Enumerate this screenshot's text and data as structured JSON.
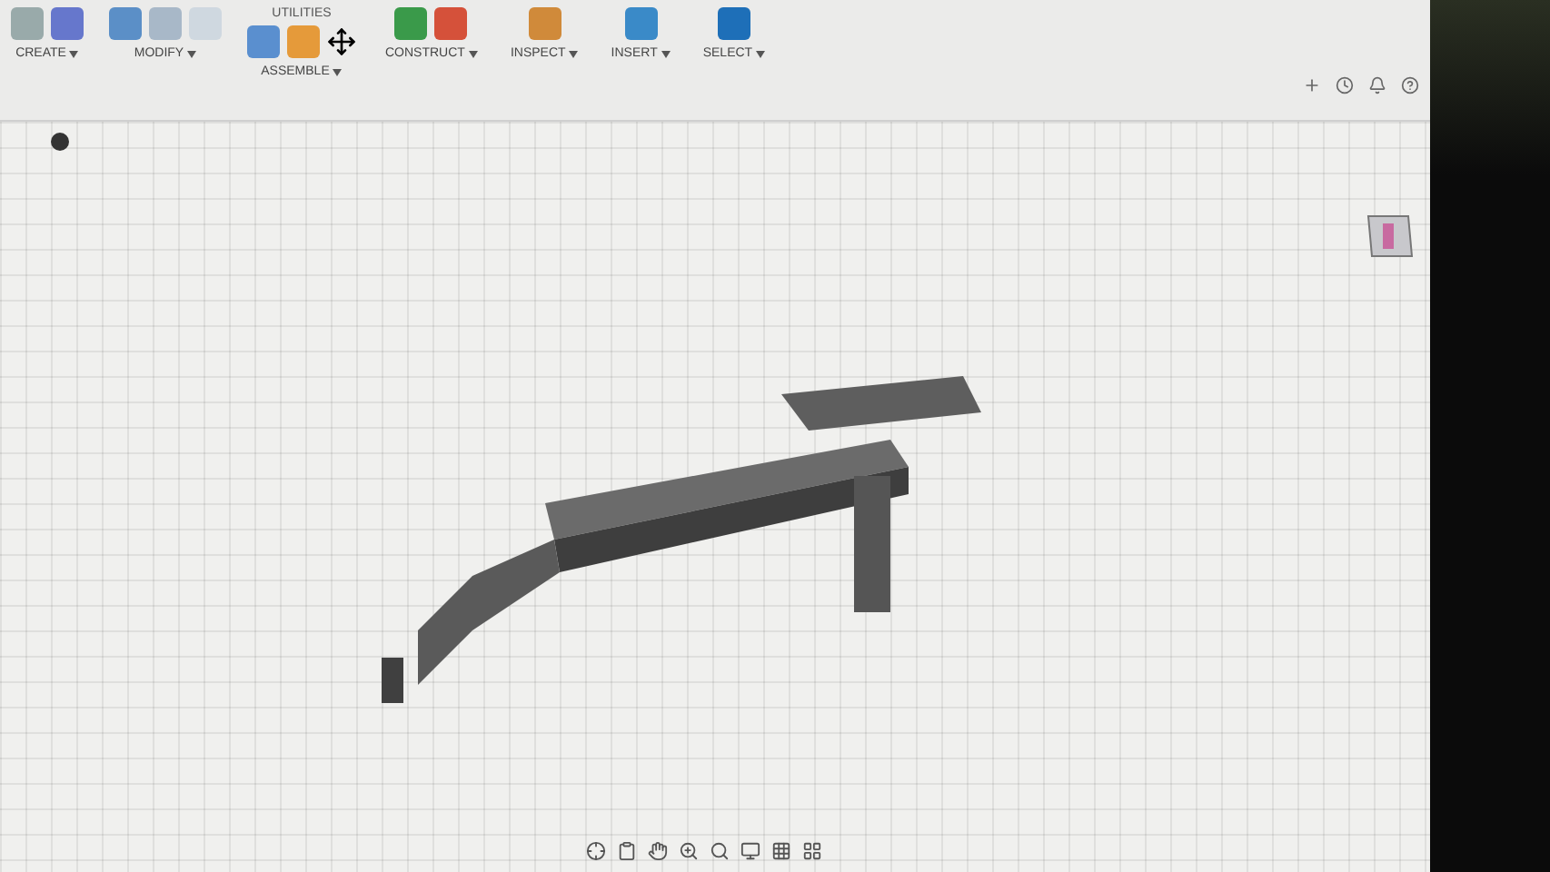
{
  "toolbar": {
    "groups": [
      {
        "label": "CREATE"
      },
      {
        "label": "MODIFY"
      },
      {
        "label": "ASSEMBLE"
      },
      {
        "label": "CONSTRUCT"
      },
      {
        "label": "INSPECT"
      },
      {
        "label": "INSERT"
      },
      {
        "label": "SELECT"
      }
    ],
    "section_label": "UTILITIES"
  },
  "browser": {
    "expanded": false
  }
}
